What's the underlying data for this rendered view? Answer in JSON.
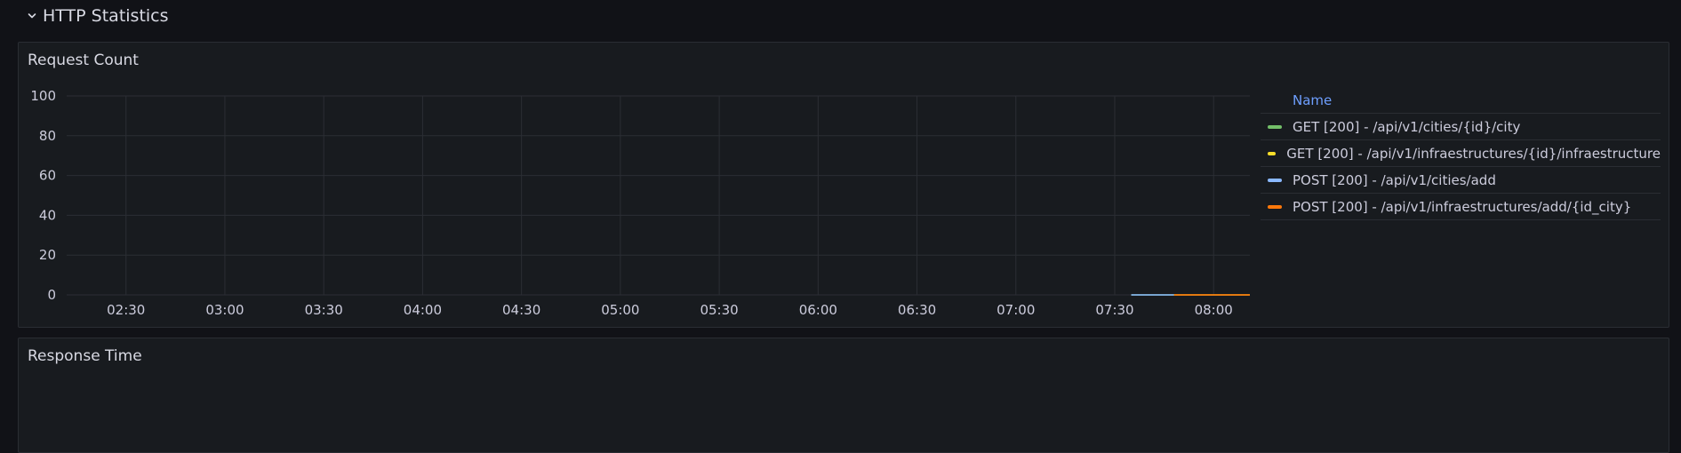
{
  "row": {
    "title": "HTTP Statistics",
    "collapse_icon": "chevron-down-icon"
  },
  "panels": {
    "request_count": {
      "title": "Request Count"
    },
    "response_time": {
      "title": "Response Time"
    }
  },
  "legend": {
    "header": "Name",
    "items": [
      {
        "label": "GET [200] - /api/v1/cities/{id}/city",
        "color": "#73bf69"
      },
      {
        "label": "GET [200] - /api/v1/infraestructures/{id}/infraestructure",
        "color": "#fade2a"
      },
      {
        "label": "POST [200] - /api/v1/cities/add",
        "color": "#8ab8ff"
      },
      {
        "label": "POST [200] - /api/v1/infraestructures/add/{id_city}",
        "color": "#ff780a"
      }
    ]
  },
  "chart_data": {
    "type": "line",
    "title": "Request Count",
    "xlabel": "",
    "ylabel": "",
    "x_ticks": [
      "02:30",
      "03:00",
      "03:30",
      "04:00",
      "04:30",
      "05:00",
      "05:30",
      "06:00",
      "06:30",
      "07:00",
      "07:30",
      "08:00"
    ],
    "y_ticks": [
      0,
      20,
      40,
      60,
      80,
      100
    ],
    "ylim": [
      0,
      100
    ],
    "xlim": [
      "02:12",
      "08:11"
    ],
    "grid": true,
    "legend_position": "right",
    "series": [
      {
        "name": "GET [200] - /api/v1/cities/{id}/city",
        "color": "#73bf69",
        "points": [
          [
            "07:35",
            0
          ],
          [
            "07:48",
            0
          ]
        ]
      },
      {
        "name": "GET [200] - /api/v1/infraestructures/{id}/infraestructure",
        "color": "#fade2a",
        "points": [
          [
            "07:48",
            0
          ],
          [
            "08:11",
            0
          ]
        ]
      },
      {
        "name": "POST [200] - /api/v1/cities/add",
        "color": "#8ab8ff",
        "points": [
          [
            "07:35",
            0
          ],
          [
            "07:48",
            0
          ]
        ]
      },
      {
        "name": "POST [200] - /api/v1/infraestructures/add/{id_city}",
        "color": "#ff780a",
        "points": [
          [
            "07:48",
            0
          ],
          [
            "08:11",
            0
          ]
        ]
      }
    ]
  }
}
